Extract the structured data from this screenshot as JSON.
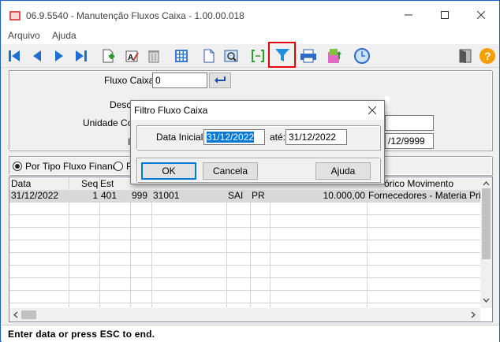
{
  "window": {
    "title": "06.9.5540 - Manutenção Fluxos Caixa - 1.00.00.018"
  },
  "menu": [
    "Arquivo",
    "Ajuda"
  ],
  "toolbar": {
    "icons": [
      "first-record-icon",
      "previous-record-icon",
      "next-record-icon",
      "last-record-icon",
      "new-record-icon",
      "edit-record-icon",
      "delete-icon",
      "calculator-icon",
      "document-icon",
      "preview-icon",
      "range-icon",
      "filter-icon",
      "print-icon",
      "export-icon",
      "clock-icon",
      "exit-door-icon",
      "help-icon"
    ]
  },
  "form": {
    "fluxo_caixa_label": "Fluxo Caixa:",
    "fluxo_caixa_value": "0",
    "descricao_label": "Descri",
    "unidade_label": "Unidade Co",
    "i_label": "I",
    "date_partial": "/12/9999"
  },
  "options": {
    "radio1": "Por Tipo Fluxo Financ",
    "radio2": "P"
  },
  "grid": {
    "headers": [
      "Data",
      "Seq",
      "Est",
      "",
      "",
      "",
      "",
      "",
      "órico Movimento"
    ],
    "rows": [
      [
        "31/12/2022",
        "1",
        "401",
        "999",
        "31001",
        "SAI",
        "PR",
        "10.000,00",
        "Fornecedores - Materia Prima"
      ]
    ]
  },
  "dialog": {
    "title": "Filtro Fluxo Caixa",
    "data_inicial_label": "Data Inicial:",
    "data_inicial_value": "31/12/2022",
    "ate_label": "até:",
    "ate_value": "31/12/2022",
    "ok_label": "OK",
    "cancel_label": "Cancela",
    "help_label": "Ajuda"
  },
  "status": {
    "text": "Enter data or press ESC to end."
  }
}
